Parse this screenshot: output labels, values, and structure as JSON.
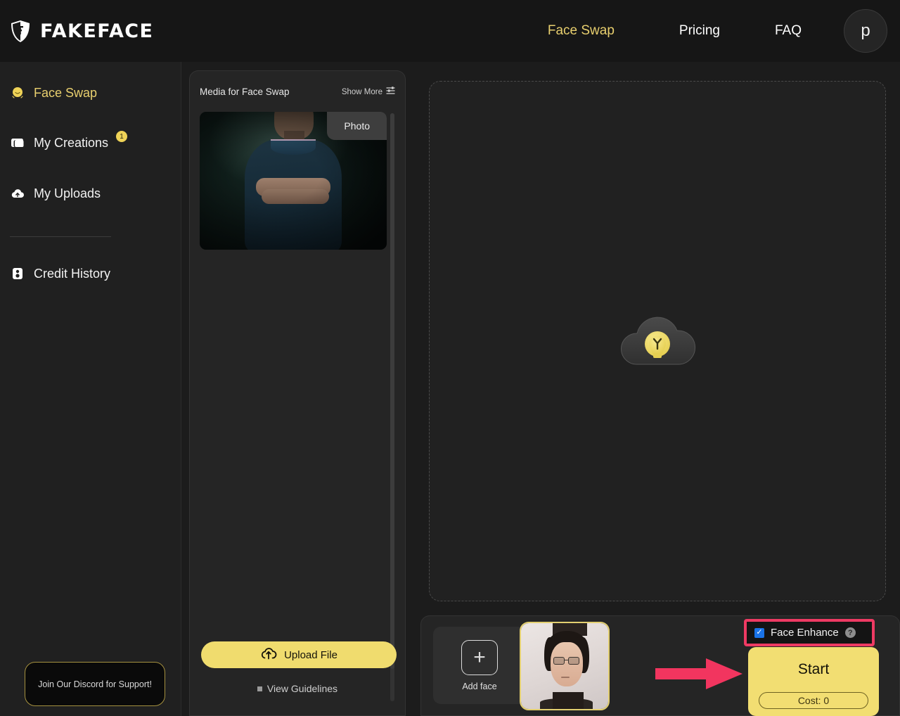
{
  "header": {
    "brand_name": "FAKEFACE",
    "brand_icon": "shield-logo-icon",
    "nav": [
      {
        "label": "Face Swap",
        "active": true
      },
      {
        "label": "Pricing",
        "active": false
      },
      {
        "label": "FAQ",
        "active": false
      }
    ],
    "avatar_initial": "p"
  },
  "sidebar": {
    "items": [
      {
        "label": "Face Swap",
        "icon": "face-icon",
        "active": true,
        "badge": null
      },
      {
        "label": "My Creations",
        "icon": "folder-icon",
        "active": false,
        "badge": "1"
      },
      {
        "label": "My Uploads",
        "icon": "cloud-upload-icon",
        "active": false,
        "badge": null
      },
      {
        "label": "Credit History",
        "icon": "credit-coin-icon",
        "active": false,
        "badge": null
      }
    ],
    "discord_cta": "Join Our Discord for Support!"
  },
  "media_panel": {
    "title": "Media for Face Swap",
    "show_more_label": "Show More",
    "show_more_icon": "sliders-filter-icon",
    "media_items": [
      {
        "type_badge": "Photo",
        "alt": "man-in-navy-polo-arms-crossed"
      }
    ],
    "upload_button": "Upload File",
    "upload_icon": "cloud-upload-icon",
    "guidelines_label": "View Guidelines",
    "guidelines_icon": "list-square-icon"
  },
  "canvas": {
    "placeholder_icon": "cloud-with-lightbulb-icon",
    "border_style": "dashed"
  },
  "bottom_bar": {
    "add_face_label": "Add face",
    "add_face_icon": "plus-icon",
    "faces": [
      {
        "selected": true,
        "alt": "man-with-glasses-portrait"
      }
    ],
    "face_enhance": {
      "label": "Face Enhance",
      "checked": true,
      "help_icon": "question-mark-icon",
      "highlight_color": "#ee3a63"
    },
    "start_button": {
      "label": "Start",
      "cost_label": "Cost: 0"
    },
    "annotation_arrow": {
      "icon": "right-arrow-annotation",
      "color": "#f2355f"
    }
  },
  "colors": {
    "accent_yellow": "#f0dc6e",
    "accent_muted_yellow": "#e8cf6e",
    "background": "#1c1c1c",
    "panel": "#252525",
    "header": "#161616",
    "annotation_pink": "#ee3a63",
    "checkbox_blue": "#1a73e8"
  }
}
